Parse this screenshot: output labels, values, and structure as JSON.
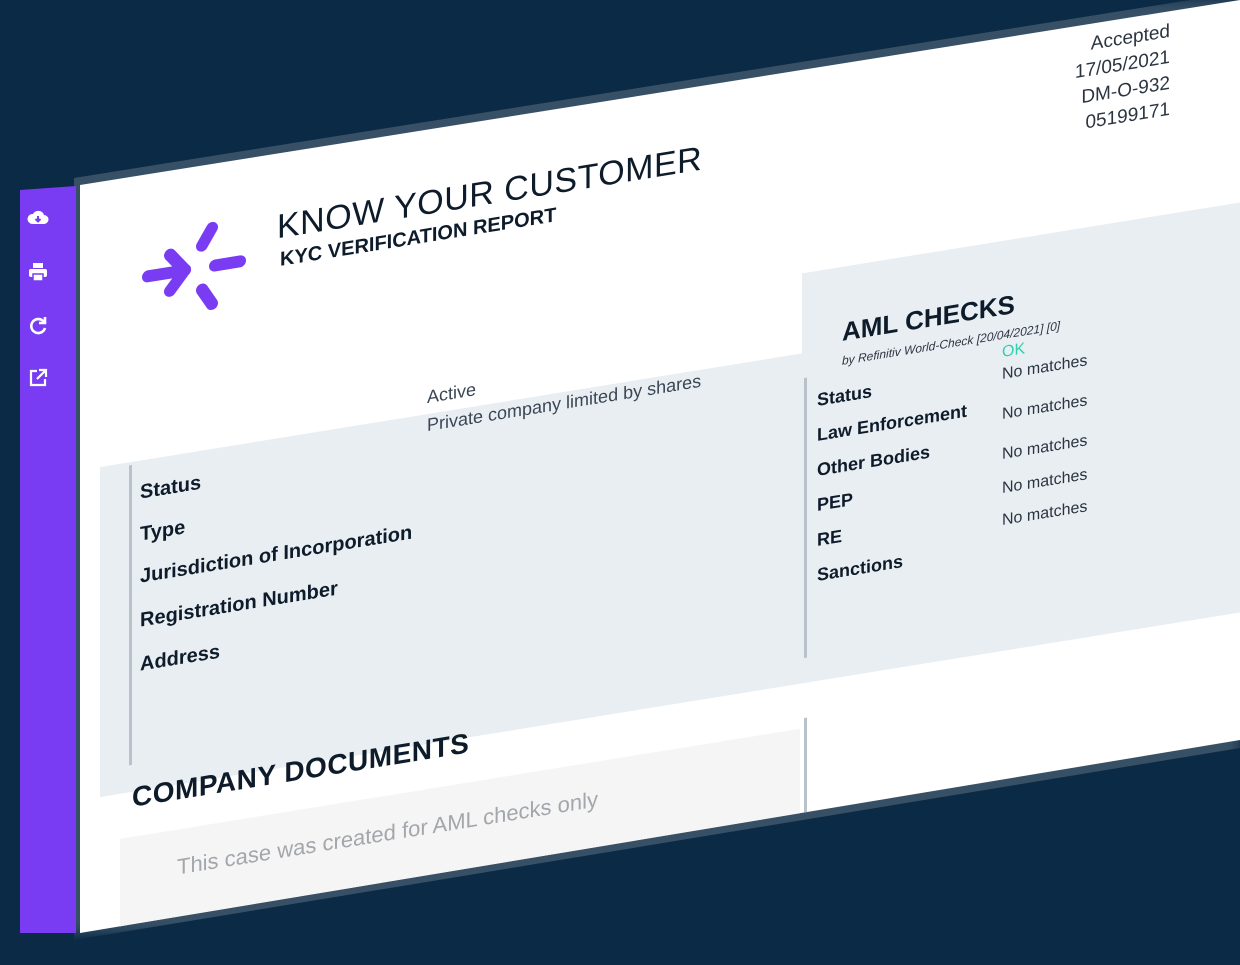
{
  "sidebar": {
    "icons": [
      "cloud-download-icon",
      "print-icon",
      "refresh-icon",
      "open-external-icon"
    ]
  },
  "header": {
    "title": "KNOW YOUR CUSTOMER",
    "subtitle": "KYC VERIFICATION REPORT",
    "meta": {
      "status": "Accepted",
      "date": "17/05/2021",
      "reference": "DM-O-932",
      "number": "05199171"
    }
  },
  "company": {
    "labels": [
      "Status",
      "Type",
      "Jurisdiction of Incorporation",
      "Registration Number",
      "Address"
    ],
    "values": [
      "Active",
      "Private company limited by shares"
    ]
  },
  "aml": {
    "title": "AML CHECKS",
    "source": "by Refinitiv World-Check [20/04/2021] [0]",
    "rows": [
      {
        "label": "Status",
        "value": "OK"
      },
      {
        "label": "Law Enforcement",
        "value": "No matches"
      },
      {
        "label": "Other Bodies",
        "value": "No matches"
      },
      {
        "label": "PEP",
        "value": "No matches"
      },
      {
        "label": "RE",
        "value": "No matches"
      },
      {
        "label": "Sanctions",
        "value": "No matches"
      }
    ]
  },
  "documents": {
    "title": "COMPANY DOCUMENTS",
    "note": "This case was created for AML checks only"
  },
  "colors": {
    "background": "#0b2a45",
    "accent": "#7a3cf2",
    "ok": "#2fd0b0"
  }
}
